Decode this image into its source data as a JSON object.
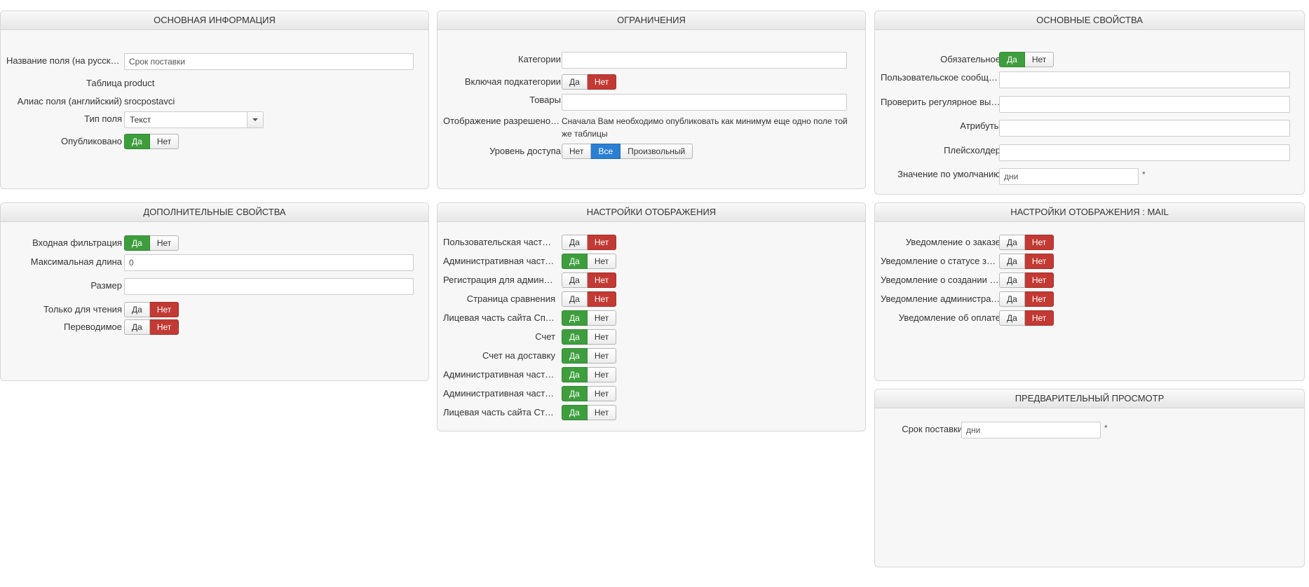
{
  "basic_info": {
    "title": "ОСНОВНАЯ ИНФОРМАЦИЯ",
    "name_label": "Название поля (на русском)",
    "name_value": "Срок поставки",
    "table_label": "Таблица",
    "table_value": "product",
    "alias_label": "Алиас поля (английский)",
    "alias_value": "srocpostavci",
    "type_label": "Тип поля",
    "type_value": "Текст",
    "published_label": "Опубликовано",
    "yes": "Да",
    "no": "Нет"
  },
  "restrictions": {
    "title": "ОГРАНИЧЕНИЯ",
    "categories_label": "Категории",
    "subcategories_label": "Включая подкатегории",
    "products_label": "Товары",
    "display_label": "Отображение разрешено после",
    "display_text": "Сначала Вам необходимо опубликовать как минимум еще одно поле той же таблицы",
    "access_label": "Уровень доступа",
    "access_options": [
      "Нет",
      "Все",
      "Произвольный"
    ],
    "yes": "Да",
    "no": "Нет"
  },
  "main_props": {
    "title": "ОСНОВНЫЕ СВОЙСТВА",
    "required_label": "Обязательное",
    "user_message_label": "Пользовательское сообщение",
    "regex_label": "Проверить регулярное выражение",
    "attributes_label": "Атрибуты",
    "placeholder_label": "Плейсхолдер",
    "default_label": "Значение по умолчанию",
    "default_value": "дни",
    "asterisk": "*",
    "yes": "Да",
    "no": "Нет"
  },
  "extra_props": {
    "title": "ДОПОЛНИТЕЛЬНЫЕ СВОЙСТВА",
    "filter_label": "Входная фильтрация",
    "maxlen_label": "Максимальная длина",
    "maxlen_value": "0",
    "size_label": "Размер",
    "readonly_label": "Только для чтения",
    "translatable_label": "Переводимое",
    "yes": "Да",
    "no": "Нет"
  },
  "display_settings": {
    "title": "НАСТРОЙКИ ОТОБРАЖЕНИЯ",
    "yes": "Да",
    "no": "Нет",
    "rows": [
      {
        "label": "Пользовательская часть сайта",
        "selected": "no"
      },
      {
        "label": "Административная часть сайта",
        "selected": "yes"
      },
      {
        "label": "Регистрация для администратора",
        "selected": "no"
      },
      {
        "label": "Страница сравнения",
        "selected": "no"
      },
      {
        "label": "Лицевая часть сайта Список товаров",
        "selected": "yes"
      },
      {
        "label": "Счет",
        "selected": "yes"
      },
      {
        "label": "Счет на доставку",
        "selected": "yes"
      },
      {
        "label": "Административная часть сайта Список",
        "selected": "yes"
      },
      {
        "label": "Административная часть сайта Заказ",
        "selected": "yes"
      },
      {
        "label": "Лицевая часть сайта Страница товара",
        "selected": "yes"
      }
    ]
  },
  "display_mail": {
    "title": "НАСТРОЙКИ ОТОБРАЖЕНИЯ : MAIL",
    "yes": "Да",
    "no": "Нет",
    "rows": [
      {
        "label": "Уведомление о заказе",
        "selected": "no"
      },
      {
        "label": "Уведомление о статусе заказа",
        "selected": "no"
      },
      {
        "label": "Уведомление о создании аккаунта",
        "selected": "no"
      },
      {
        "label": "Уведомление администратора",
        "selected": "no"
      },
      {
        "label": "Уведомление об оплате",
        "selected": "no"
      }
    ]
  },
  "preview": {
    "title": "ПРЕДВАРИТЕЛЬНЫЙ ПРОСМОТР",
    "field_label": "Срок поставки",
    "field_value": "дни",
    "asterisk": "*"
  },
  "colors": {
    "yes_active": "#3e9e3e",
    "no_active": "#c23a33",
    "all_active": "#2a7fd2"
  }
}
